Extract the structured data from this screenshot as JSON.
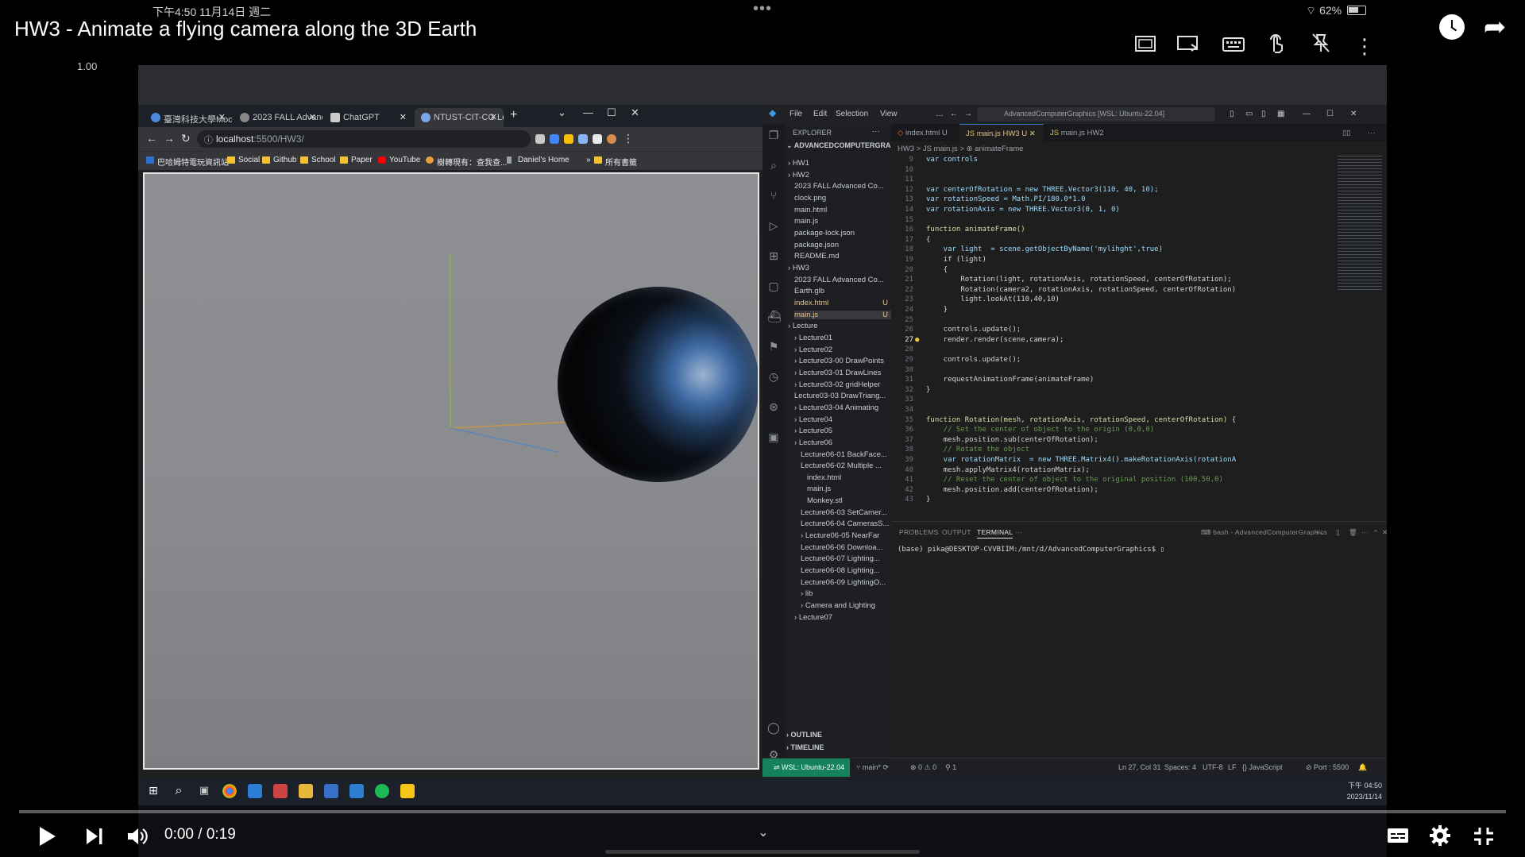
{
  "status_bar": {
    "time_date": "下午4:50   11月14日 週二",
    "wifi_battery": "62%",
    "battery_level": 0.62
  },
  "video": {
    "title": "HW3 - Animate a flying camera along the 3D Earth",
    "speed_label": "1.00",
    "time_display": "0:00 / 0:19",
    "progress": 0.0
  },
  "browser": {
    "tabs": [
      {
        "label": "臺灣科技大學Moo"
      },
      {
        "label": "2023 FALL Advanc"
      },
      {
        "label": "ChatGPT"
      },
      {
        "label": "NTUST-CIT-CG Le"
      }
    ],
    "url_host": "localhost",
    "url_path": ":5500/HW3/",
    "bookmarks": [
      "巴哈姆特電玩資訊站",
      "Social",
      "Github",
      "School",
      "Paper",
      "YouTube",
      "樹轉現有：查我查...",
      "Daniel's Home",
      "所有書籤"
    ]
  },
  "vscode": {
    "menus": [
      "File",
      "Edit",
      "Selection",
      "View"
    ],
    "command_center": "AdvancedComputerGraphics [WSL: Ubuntu-22.04]",
    "explorer_header": "EXPLORER",
    "workspace": "ADVANCEDCOMPUTERGRAPHI...",
    "tree": [
      {
        "label": "HW1",
        "indent": 0,
        "mark": ""
      },
      {
        "label": "HW2",
        "indent": 0,
        "mark": ""
      },
      {
        "label": "2023 FALL Advanced Co...",
        "indent": 1,
        "mark": ""
      },
      {
        "label": "clock.png",
        "indent": 1,
        "mark": ""
      },
      {
        "label": "main.html",
        "indent": 1,
        "mark": ""
      },
      {
        "label": "main.js",
        "indent": 1,
        "mark": ""
      },
      {
        "label": "package-lock.json",
        "indent": 1,
        "mark": ""
      },
      {
        "label": "package.json",
        "indent": 1,
        "mark": ""
      },
      {
        "label": "README.md",
        "indent": 1,
        "mark": ""
      },
      {
        "label": "HW3",
        "indent": 0,
        "mark": ""
      },
      {
        "label": "2023 FALL Advanced Co...",
        "indent": 1,
        "mark": ""
      },
      {
        "label": "Earth.glb",
        "indent": 1,
        "mark": ""
      },
      {
        "label": "index.html",
        "indent": 1,
        "mark": "U"
      },
      {
        "label": "main.js",
        "indent": 1,
        "mark": "U"
      },
      {
        "label": "Lecture",
        "indent": 0,
        "mark": ""
      },
      {
        "label": "Lecture01",
        "indent": 1,
        "mark": ""
      },
      {
        "label": "Lecture02",
        "indent": 1,
        "mark": ""
      },
      {
        "label": "Lecture03-00 DrawPoints",
        "indent": 1,
        "mark": ""
      },
      {
        "label": "Lecture03-01 DrawLines",
        "indent": 1,
        "mark": ""
      },
      {
        "label": "Lecture03-02 gridHelper",
        "indent": 1,
        "mark": ""
      },
      {
        "label": "Lecture03-03 DrawTriang...",
        "indent": 1,
        "mark": ""
      },
      {
        "label": "Lecture03-04 Animating",
        "indent": 1,
        "mark": ""
      },
      {
        "label": "Lecture04",
        "indent": 1,
        "mark": ""
      },
      {
        "label": "Lecture05",
        "indent": 1,
        "mark": ""
      },
      {
        "label": "Lecture06",
        "indent": 1,
        "mark": ""
      },
      {
        "label": "Lecture06-01 BackFace...",
        "indent": 2,
        "mark": ""
      },
      {
        "label": "Lecture06-02 Multiple ...",
        "indent": 2,
        "mark": ""
      },
      {
        "label": "index.html",
        "indent": 3,
        "mark": ""
      },
      {
        "label": "main.js",
        "indent": 3,
        "mark": ""
      },
      {
        "label": "Monkey.stl",
        "indent": 3,
        "mark": ""
      },
      {
        "label": "Lecture06-03 SetCamer...",
        "indent": 2,
        "mark": ""
      },
      {
        "label": "Lecture06-04 CamerasS...",
        "indent": 2,
        "mark": ""
      },
      {
        "label": "Lecture06-05 NearFar",
        "indent": 2,
        "mark": ""
      },
      {
        "label": "Lecture06-06 Downloa...",
        "indent": 2,
        "mark": ""
      },
      {
        "label": "Lecture06-07 Lighting...",
        "indent": 2,
        "mark": ""
      },
      {
        "label": "Lecture06-08 Lighting...",
        "indent": 2,
        "mark": ""
      },
      {
        "label": "Lecture06-09 LightingO...",
        "indent": 2,
        "mark": ""
      },
      {
        "label": "lib",
        "indent": 2,
        "mark": ""
      },
      {
        "label": "Camera and Lighting",
        "indent": 2,
        "mark": ""
      },
      {
        "label": "Lecture07",
        "indent": 1,
        "mark": ""
      }
    ],
    "outline_label": "OUTLINE",
    "timeline_label": "TIMELINE",
    "editor_tabs": [
      {
        "label": "index.html U"
      },
      {
        "label": "main.js HW3 U"
      },
      {
        "label": "main.js HW2"
      }
    ],
    "breadcrumb": "HW3 > JS main.js > ⊕ animateFrame",
    "code": [
      {
        "n": "9",
        "t": "var controls"
      },
      {
        "n": "10",
        "t": ""
      },
      {
        "n": "11",
        "t": ""
      },
      {
        "n": "12",
        "t": "var centerOfRotation = new THREE.Vector3(110, 40, 10);"
      },
      {
        "n": "13",
        "t": "var rotationSpeed = Math.PI/180.0*1.0"
      },
      {
        "n": "14",
        "t": "var rotationAxis = new THREE.Vector3(0, 1, 0)"
      },
      {
        "n": "15",
        "t": ""
      },
      {
        "n": "16",
        "t": "function animateFrame()"
      },
      {
        "n": "17",
        "t": "{"
      },
      {
        "n": "18",
        "t": "    var light  = scene.getObjectByName('mylihght',true)"
      },
      {
        "n": "19",
        "t": "    if (light)"
      },
      {
        "n": "20",
        "t": "    {"
      },
      {
        "n": "21",
        "t": "        Rotation(light, rotationAxis, rotationSpeed, centerOfRotation);"
      },
      {
        "n": "22",
        "t": "        Rotation(camera2, rotationAxis, rotationSpeed, centerOfRotation)"
      },
      {
        "n": "23",
        "t": "        light.lookAt(110,40,10)"
      },
      {
        "n": "24",
        "t": "    }"
      },
      {
        "n": "25",
        "t": ""
      },
      {
        "n": "26",
        "t": "    controls.update();"
      },
      {
        "n": "27",
        "t": "    render.render(scene,camera);"
      },
      {
        "n": "28",
        "t": ""
      },
      {
        "n": "29",
        "t": "    controls.update();"
      },
      {
        "n": "30",
        "t": ""
      },
      {
        "n": "31",
        "t": "    requestAnimationFrame(animateFrame)"
      },
      {
        "n": "32",
        "t": "}"
      },
      {
        "n": "33",
        "t": ""
      },
      {
        "n": "34",
        "t": ""
      },
      {
        "n": "35",
        "t": "function Rotation(mesh, rotationAxis, rotationSpeed, centerOfRotation) {"
      },
      {
        "n": "36",
        "t": "    // Set the center of object to the origin (0,0,0)"
      },
      {
        "n": "37",
        "t": "    mesh.position.sub(centerOfRotation);"
      },
      {
        "n": "38",
        "t": "    // Rotate the object"
      },
      {
        "n": "39",
        "t": "    var rotationMatrix  = new THREE.Matrix4().makeRotationAxis(rotationA"
      },
      {
        "n": "40",
        "t": "    mesh.applyMatrix4(rotationMatrix);"
      },
      {
        "n": "41",
        "t": "    // Reset the center of object to the original position (100,50,0)"
      },
      {
        "n": "42",
        "t": "    mesh.position.add(centerOfRotation);"
      },
      {
        "n": "43",
        "t": "}"
      }
    ],
    "current_line": "27",
    "panel_tabs": [
      "PROBLEMS",
      "OUTPUT",
      "TERMINAL"
    ],
    "panel_active": "TERMINAL",
    "terminal_title": "bash - AdvancedComputerGraphics",
    "terminal_line": "(base) pika@DESKTOP-CVVBIIM:/mnt/d/AdvancedComputerGraphics$ ▯",
    "status": {
      "remote": "WSL: Ubuntu-22.04",
      "branch": "main*",
      "problems": "⊗ 0 ⚠ 0",
      "ports_fwd": "1",
      "position": "Ln 27, Col 31",
      "spaces": "Spaces: 4",
      "encoding": "UTF-8",
      "eol": "LF",
      "language": "JavaScript",
      "port": "Port : 5500"
    }
  },
  "taskbar": {
    "time": "下午 04:50",
    "date": "2023/11/14"
  },
  "colors": {
    "progress": "#ff0000",
    "wsl_badge": "#16825d",
    "modified": "#e2c08d"
  },
  "icons": [
    "miniplayer-icon",
    "cast-icon",
    "keyboard-icon",
    "touch-icon",
    "pin-off-icon",
    "more-vert-icon",
    "watch-later-icon",
    "share-icon",
    "play-icon",
    "next-icon",
    "volume-icon",
    "chevron-down-icon",
    "captions-icon",
    "settings-icon",
    "fullscreen-exit-icon"
  ]
}
